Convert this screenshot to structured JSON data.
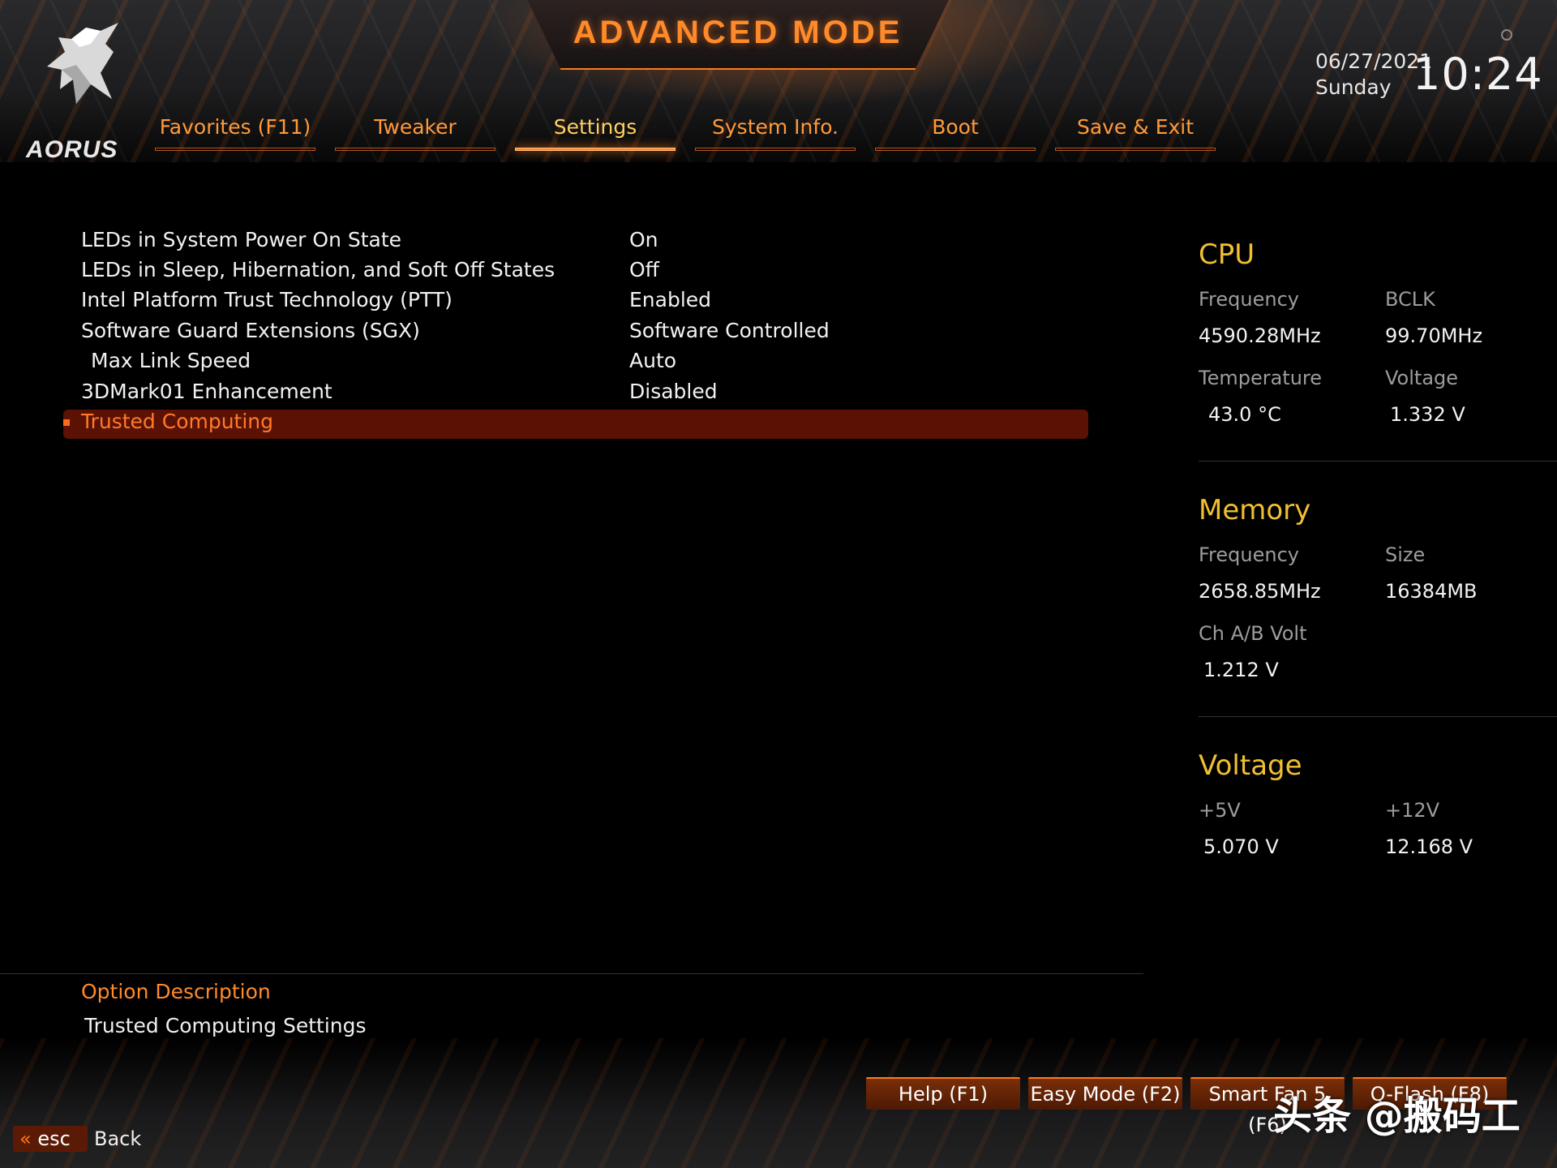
{
  "header": {
    "title": "ADVANCED MODE",
    "brand": "AORUS",
    "date": "06/27/2021",
    "day": "Sunday",
    "time": "10:24"
  },
  "tabs": [
    {
      "label": "Favorites (F11)",
      "active": false
    },
    {
      "label": "Tweaker",
      "active": false
    },
    {
      "label": "Settings",
      "active": true
    },
    {
      "label": "System Info.",
      "active": false
    },
    {
      "label": "Boot",
      "active": false
    },
    {
      "label": "Save & Exit",
      "active": false
    }
  ],
  "settings": [
    {
      "name": "LEDs in System Power On State",
      "value": "On"
    },
    {
      "name": "LEDs in Sleep, Hibernation, and Soft Off States",
      "value": "Off"
    },
    {
      "name": "Intel Platform Trust Technology (PTT)",
      "value": "Enabled"
    },
    {
      "name": "Software Guard Extensions (SGX)",
      "value": "Software Controlled"
    },
    {
      "name": " Max Link Speed",
      "value": "Auto"
    },
    {
      "name": "3DMark01 Enhancement",
      "value": "Disabled"
    }
  ],
  "selected_item": "Trusted Computing",
  "cpu": {
    "title": "CPU",
    "frequency_label": "Frequency",
    "frequency": "4590.28MHz",
    "bclk_label": "BCLK",
    "bclk": "99.70MHz",
    "temperature_label": "Temperature",
    "temperature": "43.0 °C",
    "voltage_label": "Voltage",
    "voltage": "1.332 V"
  },
  "memory": {
    "title": "Memory",
    "frequency_label": "Frequency",
    "frequency": "2658.85MHz",
    "size_label": "Size",
    "size": "16384MB",
    "volt_label": "Ch A/B Volt",
    "volt": "1.212 V"
  },
  "voltage": {
    "title": "Voltage",
    "v5_label": "+5V",
    "v5": "5.070 V",
    "v12_label": "+12V",
    "v12": "12.168 V"
  },
  "description": {
    "title": "Option Description",
    "text": "Trusted Computing Settings"
  },
  "footer": {
    "help": "Help (F1)",
    "easy_mode": "Easy Mode (F2)",
    "smart_fan": "Smart Fan 5 (F6)",
    "qflash": "Q-Flash (F8)",
    "esc": "esc",
    "back": "Back",
    "watermark": "头条 @搬码工"
  },
  "colors": {
    "accent": "#ff8a2a",
    "active_tab": "#ffd060",
    "panel_title": "#f0c030",
    "selection": "#5b1204"
  },
  "icons": [
    "aorus-eagle-logo-icon",
    "settings-dot-icon",
    "double-chevron-left-icon"
  ]
}
